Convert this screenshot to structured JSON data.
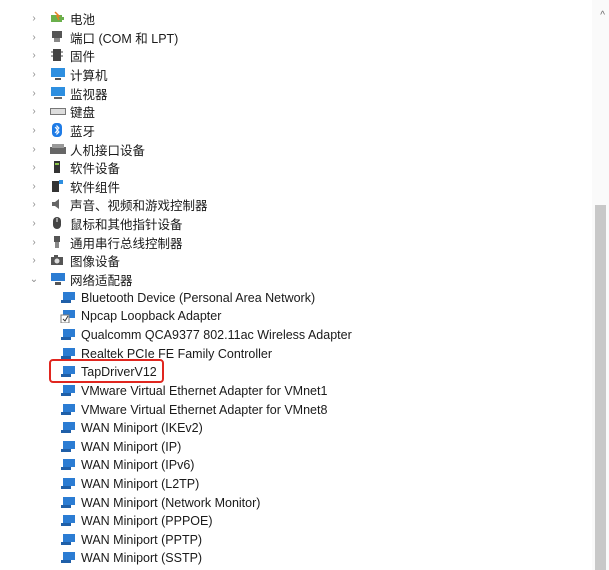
{
  "categories": [
    {
      "label": "电池",
      "icon": "battery-icon"
    },
    {
      "label": "端口 (COM 和 LPT)",
      "icon": "port-icon"
    },
    {
      "label": "固件",
      "icon": "firmware-icon"
    },
    {
      "label": "计算机",
      "icon": "computer-icon"
    },
    {
      "label": "监视器",
      "icon": "monitor-icon"
    },
    {
      "label": "键盘",
      "icon": "keyboard-icon"
    },
    {
      "label": "蓝牙",
      "icon": "bluetooth-icon"
    },
    {
      "label": "人机接口设备",
      "icon": "hid-icon"
    },
    {
      "label": "软件设备",
      "icon": "software-device-icon"
    },
    {
      "label": "软件组件",
      "icon": "software-component-icon"
    },
    {
      "label": "声音、视频和游戏控制器",
      "icon": "speaker-icon"
    },
    {
      "label": "鼠标和其他指针设备",
      "icon": "mouse-icon"
    },
    {
      "label": "通用串行总线控制器",
      "icon": "usb-icon"
    },
    {
      "label": "图像设备",
      "icon": "camera-icon"
    },
    {
      "label": "网络适配器",
      "icon": "network-adapter-icon"
    }
  ],
  "adapters": [
    {
      "label": "Bluetooth Device (Personal Area Network)"
    },
    {
      "label": "Npcap Loopback Adapter"
    },
    {
      "label": "Qualcomm QCA9377 802.11ac Wireless Adapter"
    },
    {
      "label": "Realtek PCIe FE Family Controller"
    },
    {
      "label": "TapDriverV12"
    },
    {
      "label": "VMware Virtual Ethernet Adapter for VMnet1"
    },
    {
      "label": "VMware Virtual Ethernet Adapter for VMnet8"
    },
    {
      "label": "WAN Miniport (IKEv2)"
    },
    {
      "label": "WAN Miniport (IP)"
    },
    {
      "label": "WAN Miniport (IPv6)"
    },
    {
      "label": "WAN Miniport (L2TP)"
    },
    {
      "label": "WAN Miniport (Network Monitor)"
    },
    {
      "label": "WAN Miniport (PPPOE)"
    },
    {
      "label": "WAN Miniport (PPTP)"
    },
    {
      "label": "WAN Miniport (SSTP)"
    }
  ],
  "glyphs": {
    "collapsed": "›",
    "expanded": "⌄",
    "scroll_up": "^"
  },
  "colors": {
    "highlight": "#e0261f",
    "adapter_icon": "#2b7cd3"
  }
}
